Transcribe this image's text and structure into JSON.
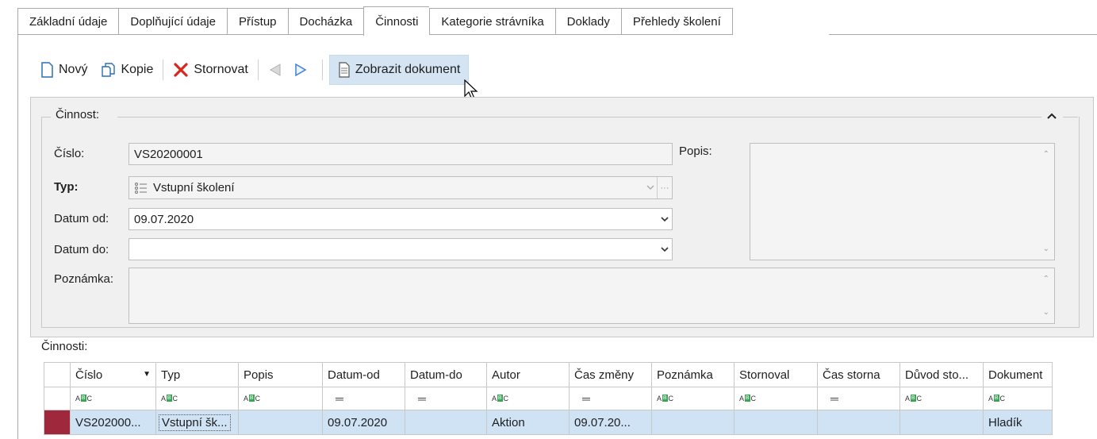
{
  "tabs": [
    {
      "label": "Základní údaje"
    },
    {
      "label": "Doplňující údaje"
    },
    {
      "label": "Přístup"
    },
    {
      "label": "Docházka"
    },
    {
      "label": "Činnosti",
      "active": true
    },
    {
      "label": "Kategorie strávníka"
    },
    {
      "label": "Doklady"
    },
    {
      "label": "Přehledy školení"
    }
  ],
  "toolbar": {
    "new_label": "Nový",
    "copy_label": "Kopie",
    "cancel_label": "Stornovat",
    "show_doc_label": "Zobrazit dokument"
  },
  "group": {
    "title": "Činnost:"
  },
  "form": {
    "cislo_label": "Číslo:",
    "cislo_value": "VS20200001",
    "typ_label": "Typ:",
    "typ_value": "Vstupní školení",
    "datum_od_label": "Datum od:",
    "datum_od_value": "09.07.2020",
    "datum_do_label": "Datum do:",
    "datum_do_value": "",
    "poznamka_label": "Poznámka:",
    "poznamka_value": "",
    "popis_label": "Popis:",
    "popis_value": ""
  },
  "grid": {
    "title": "Činnosti:",
    "columns": [
      "Číslo",
      "Typ",
      "Popis",
      "Datum-od",
      "Datum-do",
      "Autor",
      "Čas změny",
      "Poznámka",
      "Stornoval",
      "Čas storna",
      "Důvod sto...",
      "Dokument"
    ],
    "rows": [
      [
        "VS202000...",
        "Vstupní šk...",
        "",
        "09.07.2020",
        "",
        "Aktion",
        "09.07.20...",
        "",
        "",
        "",
        "",
        "Hladík"
      ]
    ]
  },
  "colors": {
    "selected_row": "#cfe3f5",
    "toolbar_hover": "#d4e4f3",
    "row_indicator": "#a0283c",
    "panel_bg": "#f0f0f0"
  }
}
